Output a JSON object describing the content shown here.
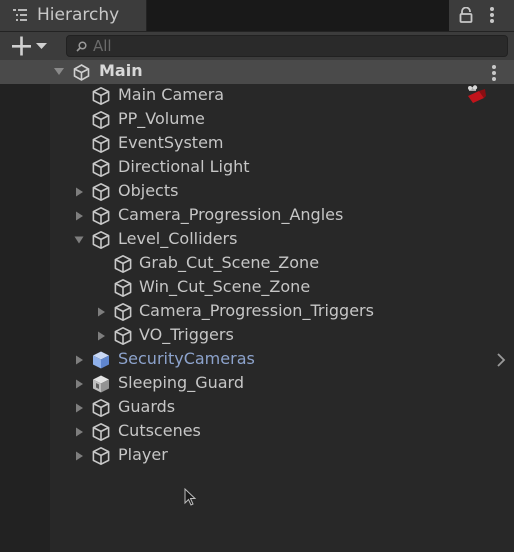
{
  "window": {
    "tab_title": "Hierarchy",
    "tab_icon": "hierarchy-list-icon",
    "lock_icon": "lock-icon",
    "menu_icon": "vertical-dots-icon"
  },
  "toolbar": {
    "create_icon": "plus-dropdown-icon",
    "search_placeholder": "All",
    "search_value": ""
  },
  "scene": {
    "name": "Main",
    "icon": "unity-scene-icon",
    "expanded": true,
    "menu_icon": "vertical-dots-icon"
  },
  "items": [
    {
      "label": "Main Camera",
      "depth": 1,
      "arrow": "none",
      "icon": "gameobject-cube-icon",
      "badge": "camera-gizmo-icon"
    },
    {
      "label": "PP_Volume",
      "depth": 1,
      "arrow": "none",
      "icon": "gameobject-cube-icon"
    },
    {
      "label": "EventSystem",
      "depth": 1,
      "arrow": "none",
      "icon": "gameobject-cube-icon"
    },
    {
      "label": "Directional Light",
      "depth": 1,
      "arrow": "none",
      "icon": "gameobject-cube-icon"
    },
    {
      "label": "Objects",
      "depth": 1,
      "arrow": "collapsed",
      "icon": "gameobject-cube-icon"
    },
    {
      "label": "Camera_Progression_Angles",
      "depth": 1,
      "arrow": "collapsed",
      "icon": "gameobject-cube-icon"
    },
    {
      "label": "Level_Colliders",
      "depth": 1,
      "arrow": "expanded",
      "icon": "gameobject-cube-icon"
    },
    {
      "label": "Grab_Cut_Scene_Zone",
      "depth": 2,
      "arrow": "none",
      "icon": "gameobject-cube-icon"
    },
    {
      "label": "Win_Cut_Scene_Zone",
      "depth": 2,
      "arrow": "none",
      "icon": "gameobject-cube-icon"
    },
    {
      "label": "Camera_Progression_Triggers",
      "depth": 2,
      "arrow": "collapsed",
      "icon": "gameobject-cube-icon"
    },
    {
      "label": "VO_Triggers",
      "depth": 2,
      "arrow": "collapsed",
      "icon": "gameobject-cube-icon"
    },
    {
      "label": "SecurityCameras",
      "depth": 1,
      "arrow": "collapsed",
      "icon": "prefab-cube-icon",
      "prefab": true,
      "chevron": "chevron-right-icon"
    },
    {
      "label": "Sleeping_Guard",
      "depth": 1,
      "arrow": "collapsed",
      "icon": "prefab-variant-cube-icon"
    },
    {
      "label": "Guards",
      "depth": 1,
      "arrow": "collapsed",
      "icon": "gameobject-cube-icon"
    },
    {
      "label": "Cutscenes",
      "depth": 1,
      "arrow": "collapsed",
      "icon": "gameobject-cube-icon"
    },
    {
      "label": "Player",
      "depth": 1,
      "arrow": "collapsed",
      "icon": "gameobject-cube-icon"
    }
  ],
  "cursor_icon": "mouse-pointer-icon",
  "colors": {
    "background": "#282828",
    "panel": "#3c3c3c",
    "scene_row": "#4a4a4a",
    "text": "#c6c6c6",
    "prefab_text": "#8da3cc"
  }
}
